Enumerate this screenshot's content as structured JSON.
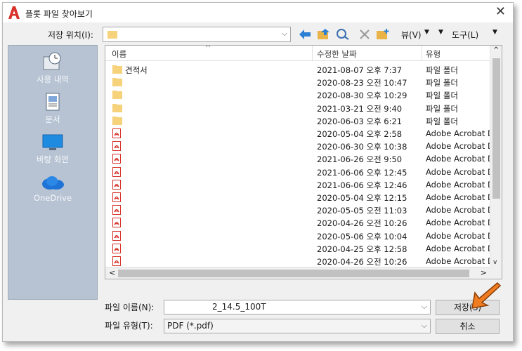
{
  "window": {
    "title": "플롯 파일 찾아보기",
    "close": "✕"
  },
  "location": {
    "label": "저장 위치(I):",
    "value": ""
  },
  "toolbar": {
    "view_label": "뷰(V)",
    "tools_label": "도구(L)"
  },
  "places": [
    {
      "label": "사용 내역",
      "icon": "history-icon"
    },
    {
      "label": "문서",
      "icon": "documents-icon"
    },
    {
      "label": "바탕 화면",
      "icon": "desktop-icon"
    },
    {
      "label": "OneDrive",
      "icon": "onedrive-icon"
    }
  ],
  "columns": {
    "name": "이름",
    "modified": "수정한 날짜",
    "type": "유형"
  },
  "files": [
    {
      "name": "견적서",
      "modified": "2021-08-07 오후 7:37",
      "type": "파일 폴더",
      "kind": "folder"
    },
    {
      "name": "",
      "modified": "2020-08-23 오전 10:47",
      "type": "파일 폴더",
      "kind": "folder"
    },
    {
      "name": "",
      "modified": "2020-08-30 오후 10:29",
      "type": "파일 폴더",
      "kind": "folder"
    },
    {
      "name": "",
      "modified": "2021-03-21 오전 9:40",
      "type": "파일 폴더",
      "kind": "folder"
    },
    {
      "name": "",
      "modified": "2020-06-03 오후 6:21",
      "type": "파일 폴더",
      "kind": "folder"
    },
    {
      "name": "",
      "modified": "2020-05-04 오후 2:58",
      "type": "Adobe Acrobat Dc",
      "kind": "pdf"
    },
    {
      "name": "",
      "modified": "2020-06-30 오후 10:38",
      "type": "Adobe Acrobat Dc",
      "kind": "pdf"
    },
    {
      "name": "",
      "modified": "2021-06-26 오전 9:50",
      "type": "Adobe Acrobat Dc",
      "kind": "pdf"
    },
    {
      "name": "",
      "modified": "2021-06-06 오후 12:45",
      "type": "Adobe Acrobat Dc",
      "kind": "pdf"
    },
    {
      "name": "",
      "modified": "2021-06-06 오후 12:46",
      "type": "Adobe Acrobat Dc",
      "kind": "pdf"
    },
    {
      "name": "",
      "modified": "2020-05-04 오후 12:15",
      "type": "Adobe Acrobat Dc",
      "kind": "pdf"
    },
    {
      "name": "",
      "modified": "2020-05-05 오전 11:03",
      "type": "Adobe Acrobat Dc",
      "kind": "pdf"
    },
    {
      "name": "",
      "modified": "2020-04-26 오전 10:26",
      "type": "Adobe Acrobat Dc",
      "kind": "pdf"
    },
    {
      "name": "",
      "modified": "2020-05-06 오후 10:04",
      "type": "Adobe Acrobat Dc",
      "kind": "pdf"
    },
    {
      "name": "",
      "modified": "2020-04-25 오후 12:58",
      "type": "Adobe Acrobat Dc",
      "kind": "pdf"
    },
    {
      "name": "",
      "modified": "2020-04-26 오전 10:26",
      "type": "Adobe Acrobat Dc",
      "kind": "pdf"
    }
  ],
  "filename": {
    "label": "파일 이름(N):",
    "value": "2_14.5_100T"
  },
  "filetype": {
    "label": "파일 유형(T):",
    "value": "PDF (*.pdf)"
  },
  "buttons": {
    "save": "저장(S)",
    "cancel": "취소"
  },
  "colors": {
    "accent": "#e03a1e",
    "folder": "#f6d27a",
    "pdf": "#d8322a",
    "places_bg": "#b7c3d3",
    "arrow": "#f07c22"
  }
}
